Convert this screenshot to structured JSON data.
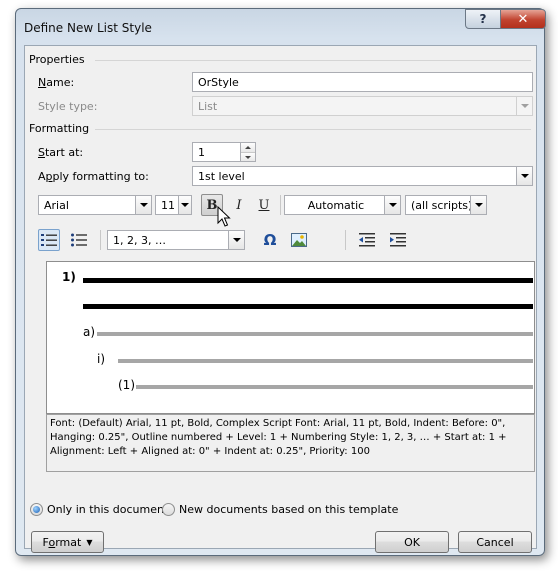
{
  "window": {
    "title": "Define New List Style",
    "help_label": "?",
    "close_label": "✕"
  },
  "properties": {
    "section_title": "Properties",
    "name_label": "Name:",
    "name_value": "OrStyle",
    "style_type_label": "Style type:",
    "style_type_value": "List"
  },
  "formatting": {
    "section_title": "Formatting",
    "start_at_label": "Start at:",
    "start_at_value": "1",
    "apply_label": "Apply formatting to:",
    "apply_value": "1st level",
    "font_name": "Arial",
    "font_size": "11",
    "bold_label": "B",
    "italic_label": "I",
    "underline_label": "U",
    "color_value": "Automatic",
    "script_value": "(all scripts)",
    "numbering_style_value": "1, 2, 3, …",
    "symbol_label": "Ω",
    "icons": [
      "numbered-list-icon",
      "bulleted-list-icon",
      "insert-picture-icon",
      "decrease-indent-icon",
      "increase-indent-icon",
      "mouse-cursor-icon"
    ]
  },
  "preview": {
    "level1": "1)",
    "level2": "a)",
    "level3": "i)",
    "level4": "(1)"
  },
  "description": "Font: (Default) Arial, 11 pt, Bold, Complex Script Font: Arial, 11 pt, Bold, Indent: Before:  0\", Hanging:  0.25\", Outline numbered + Level: 1 + Numbering Style: 1, 2, 3, … + Start at: 1 + Alignment: Left + Aligned at:  0\" + Indent at:  0.25\", Priority: 100",
  "options": {
    "only_this_document": "Only in this document",
    "new_documents": "New documents based on this template"
  },
  "buttons": {
    "format": "Format",
    "ok": "OK",
    "cancel": "Cancel"
  },
  "colors": {
    "accent": "#1a5fb4",
    "close_red": "#c1432f",
    "preview_thick": "#000000",
    "preview_thin": "#a6a6a6"
  }
}
